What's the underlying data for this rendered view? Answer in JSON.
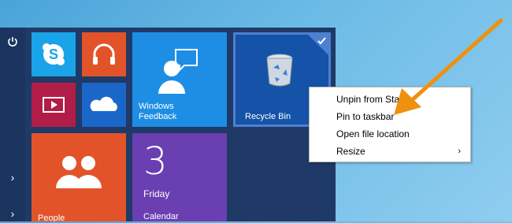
{
  "rail": {
    "power_icon": "power-icon",
    "expand1": "›",
    "expand2": "›"
  },
  "tiles": {
    "skype": {
      "icon": "skype-icon",
      "color": "#1aa3e8"
    },
    "music": {
      "icon": "headphones-icon",
      "color": "#e2532a"
    },
    "video": {
      "icon": "video-icon",
      "color": "#b21d47"
    },
    "onedrive": {
      "icon": "onedrive-icon",
      "color": "#1b66c9"
    },
    "feedback": {
      "label_line1": "Windows",
      "label_line2": "Feedback",
      "color": "#1e8ee4"
    },
    "recycle": {
      "label": "Recycle Bin",
      "color": "#1453a8",
      "selected": true
    },
    "people": {
      "label": "People",
      "color": "#e2532a"
    },
    "calendar": {
      "number": "3",
      "day": "Friday",
      "label": "Calendar",
      "color": "#6a3fb2"
    }
  },
  "context_menu": {
    "items": [
      {
        "label": "Unpin from Start"
      },
      {
        "label": "Pin to taskbar"
      },
      {
        "label": "Open file location"
      },
      {
        "label": "Resize",
        "submenu": "›"
      }
    ]
  },
  "annotation": {
    "arrow_color": "#f0900f"
  }
}
